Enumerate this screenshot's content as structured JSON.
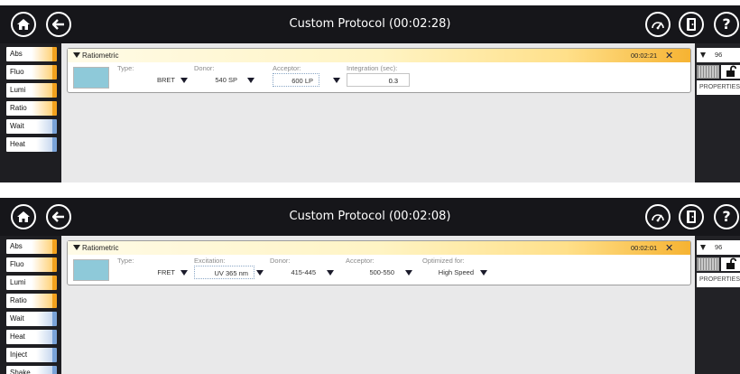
{
  "colors": {
    "topbar": "#16161a",
    "panel_header_accent": "#f6b332",
    "active_side_tab": "#f3a21d",
    "inactive_side_tab": "#7aa3d8",
    "color_swatch": "#8ec9d9"
  },
  "icons": {
    "home": "home-icon",
    "back": "back-arrow-icon",
    "settings": "gauge-icon",
    "exit": "exit-door-icon",
    "help": "help-icon",
    "lock": "lock-icon"
  },
  "screen1": {
    "title": "Custom Protocol (00:02:28)",
    "side_tabs": [
      {
        "label": "Abs",
        "active": true
      },
      {
        "label": "Fluo",
        "active": true
      },
      {
        "label": "Lumi",
        "active": true
      },
      {
        "label": "Ratio",
        "active": true
      },
      {
        "label": "Wait",
        "active": false
      },
      {
        "label": "Heat",
        "active": false
      }
    ],
    "step": {
      "name": "Ratiometric",
      "time": "00:02:21",
      "close": "✕",
      "fields": [
        {
          "label": "Type:",
          "value": "BRET"
        },
        {
          "label": "Donor:",
          "value": "540 SP"
        },
        {
          "label": "Acceptor:",
          "value": "600 LP"
        },
        {
          "label": "Integration (sec):",
          "value": "0.3"
        }
      ]
    },
    "right": {
      "plate": "96",
      "properties": "PROPERTIES"
    }
  },
  "screen2": {
    "title": "Custom Protocol (00:02:08)",
    "side_tabs": [
      {
        "label": "Abs",
        "active": true
      },
      {
        "label": "Fluo",
        "active": true
      },
      {
        "label": "Lumi",
        "active": true
      },
      {
        "label": "Ratio",
        "active": true
      },
      {
        "label": "Wait",
        "active": false
      },
      {
        "label": "Heat",
        "active": false
      },
      {
        "label": "Inject",
        "active": false
      },
      {
        "label": "Shake",
        "active": false
      }
    ],
    "step": {
      "name": "Ratiometric",
      "time": "00:02:01",
      "close": "✕",
      "fields": [
        {
          "label": "Type:",
          "value": "FRET"
        },
        {
          "label": "Excitation:",
          "value": "UV 365 nm"
        },
        {
          "label": "Donor:",
          "value": "415-445"
        },
        {
          "label": "Acceptor:",
          "value": "500-550"
        },
        {
          "label": "Optimized for:",
          "value": "High Speed"
        }
      ]
    },
    "right": {
      "plate": "96",
      "properties": "PROPERTIES"
    }
  }
}
